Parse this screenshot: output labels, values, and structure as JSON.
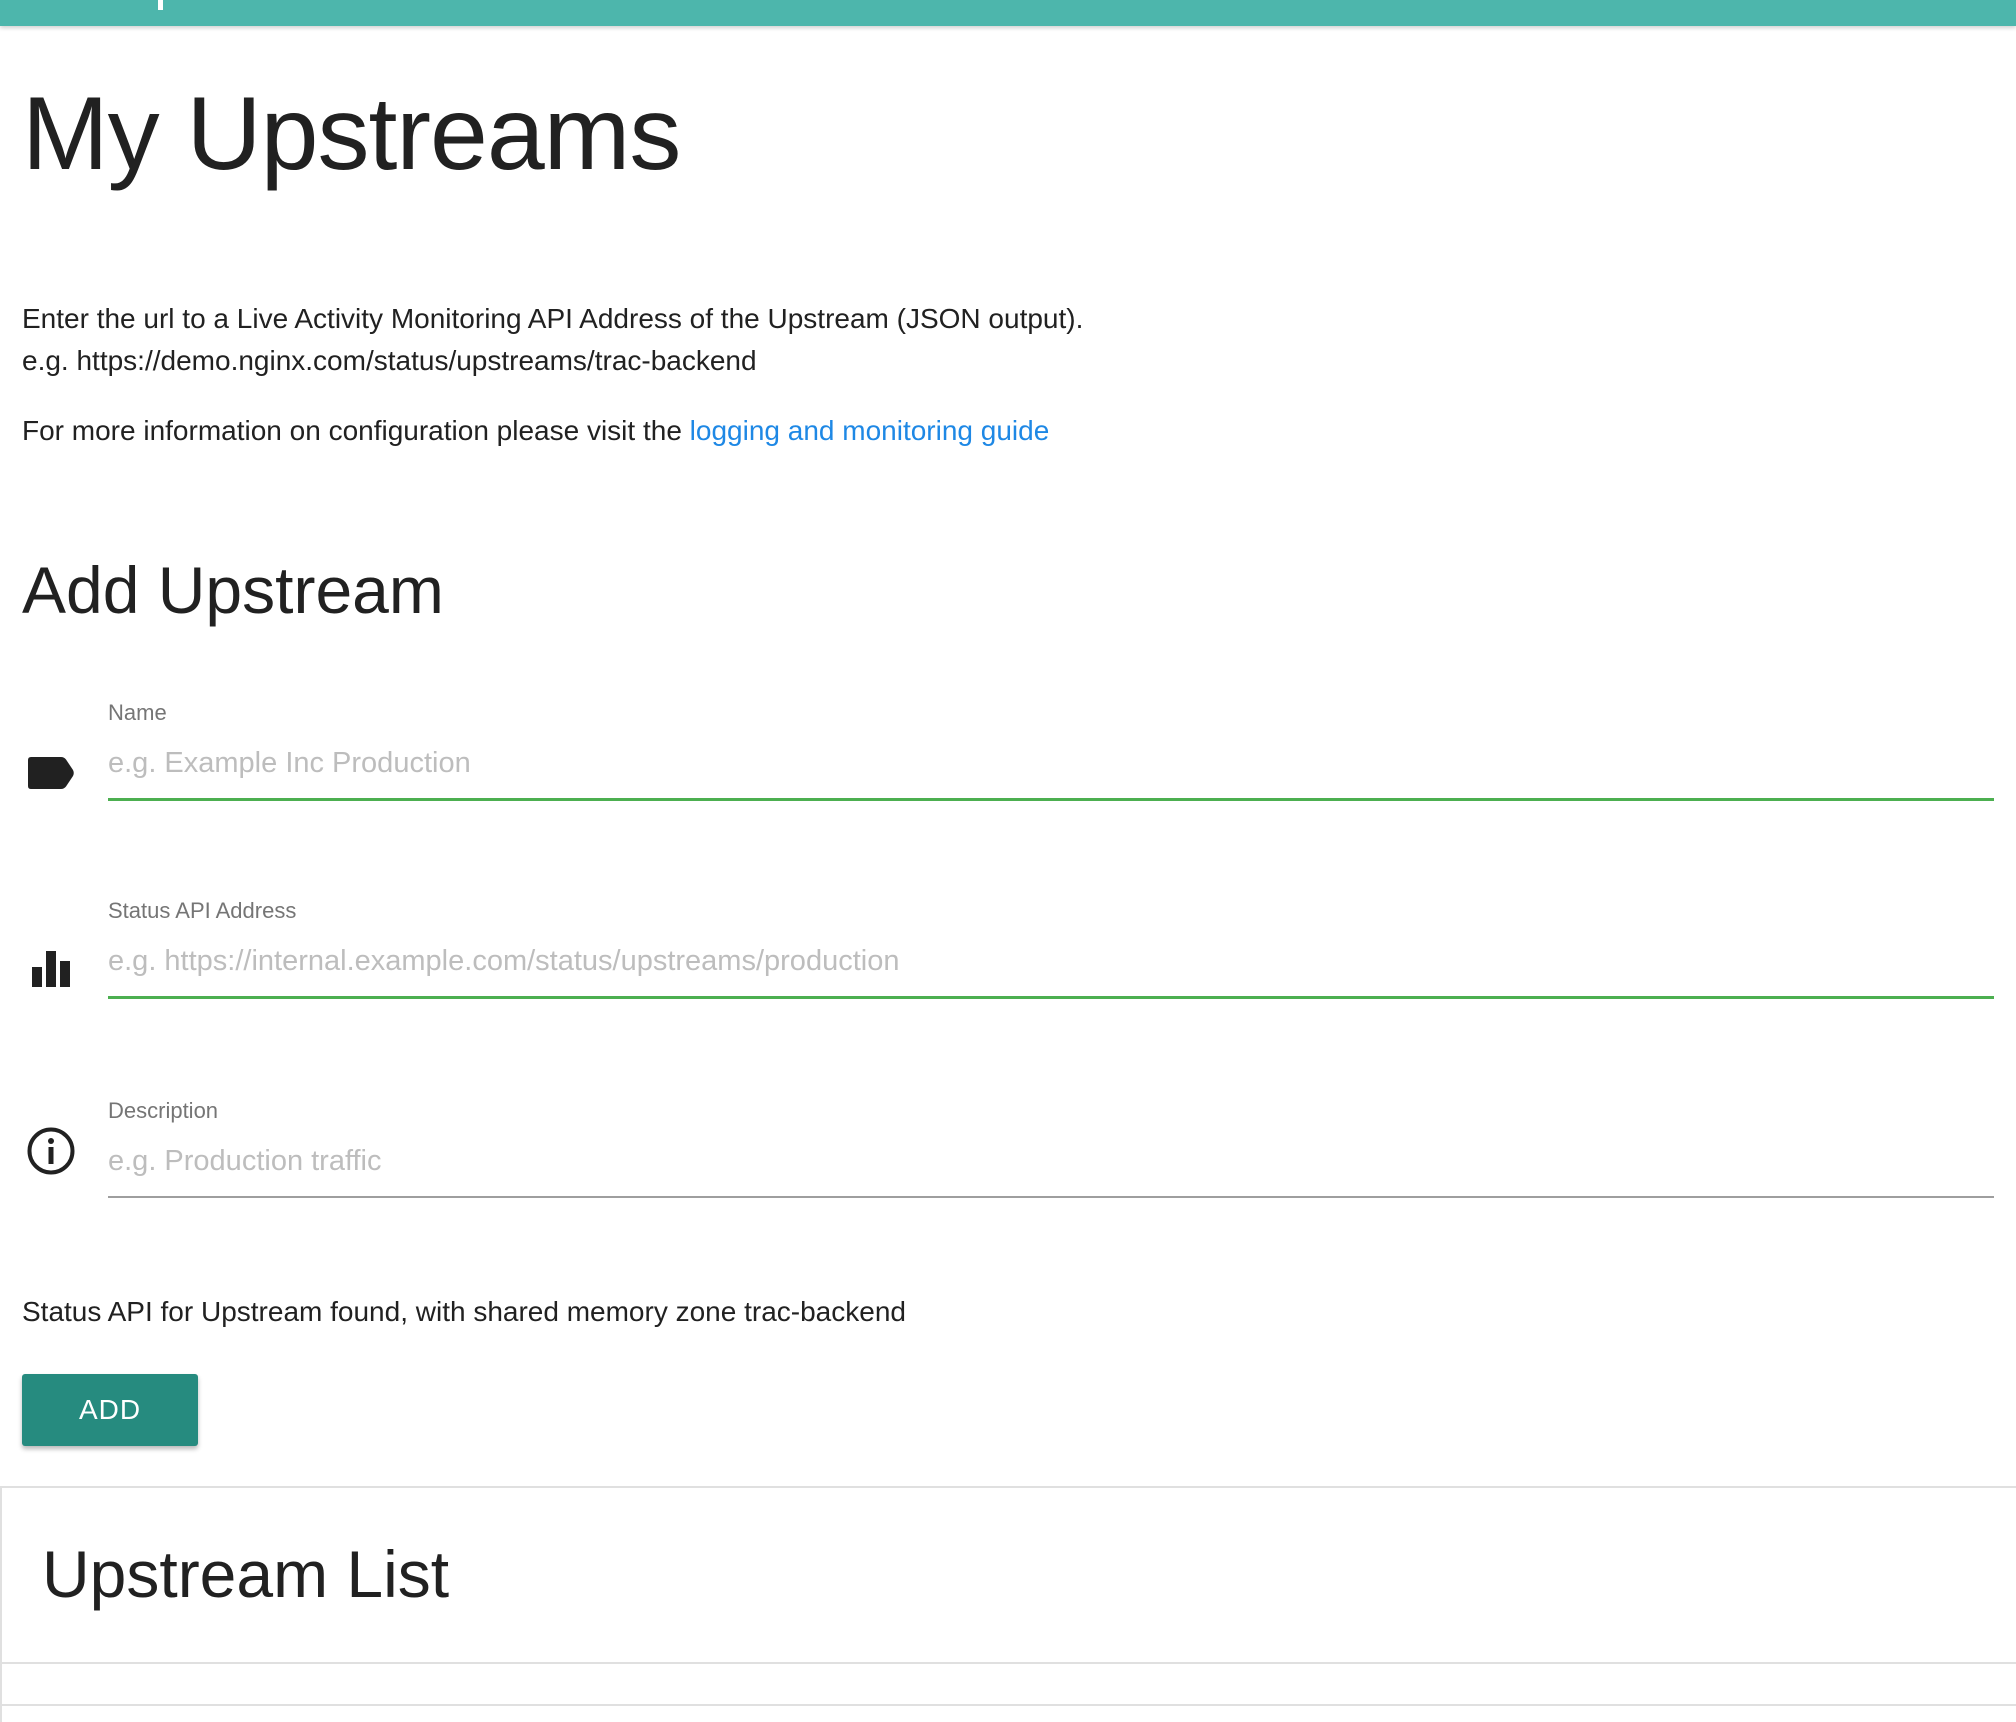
{
  "colors": {
    "topbar": "#4db6ac",
    "accent_button": "#268b7f",
    "link": "#1e88e5",
    "active_underline": "#4caf50"
  },
  "page": {
    "title": "My Upstreams"
  },
  "intro": {
    "line1": "Enter the url to a Live Activity Monitoring API Address of the Upstream (JSON output).",
    "line2": "e.g. https://demo.nginx.com/status/upstreams/trac-backend",
    "more_prefix": "For more information on configuration please visit the ",
    "more_link": "logging and monitoring guide"
  },
  "add_section": {
    "title": "Add Upstream",
    "fields": [
      {
        "label": "Name",
        "placeholder": "e.g. Example Inc Production",
        "value": "",
        "icon": "label-tag-icon"
      },
      {
        "label": "Status API Address",
        "placeholder": "e.g. https://internal.example.com/status/upstreams/production",
        "value": "",
        "icon": "bar-chart-icon"
      },
      {
        "label": "Description",
        "placeholder": "e.g. Production traffic",
        "value": "",
        "icon": "info-circle-icon"
      }
    ],
    "status_message": "Status API for Upstream found, with shared memory zone trac-backend",
    "add_button_label": "ADD"
  },
  "upstream_list": {
    "title": "Upstream List"
  }
}
